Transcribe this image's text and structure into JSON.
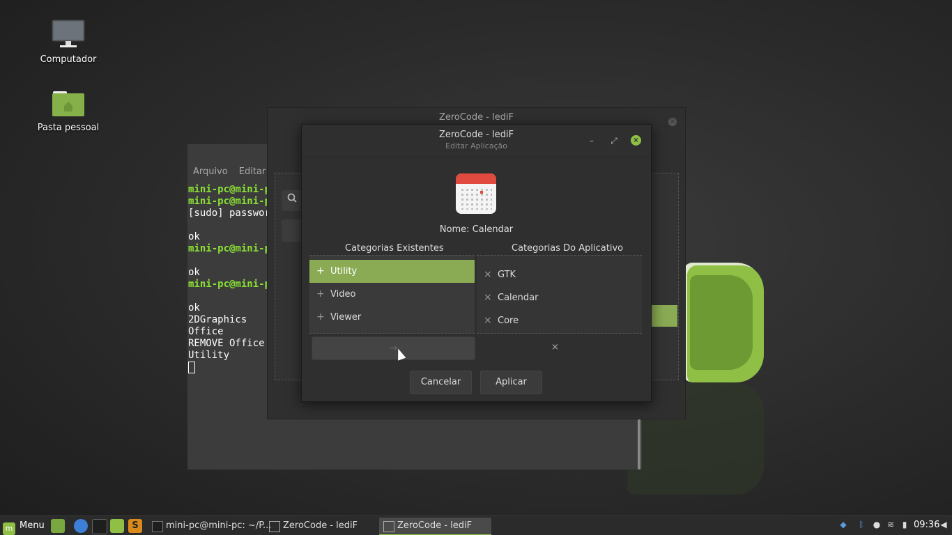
{
  "desktop": {
    "icons": [
      {
        "label": "Computador",
        "icon": "computer-icon"
      },
      {
        "label": "Pasta pessoal",
        "icon": "home-folder-icon"
      }
    ]
  },
  "terminal": {
    "menu": [
      "Arquivo",
      "Editar"
    ],
    "lines": [
      {
        "text": "mini-pc@mini-p",
        "style": "prompt"
      },
      {
        "text": "mini-pc@mini-p",
        "style": "prompt"
      },
      {
        "text": "[sudo] passwor",
        "style": "plain"
      },
      {
        "text": "",
        "style": "plain"
      },
      {
        "text": "ok",
        "style": "plain"
      },
      {
        "text": "mini-pc@mini-p",
        "style": "prompt"
      },
      {
        "text": "",
        "style": "plain"
      },
      {
        "text": "ok",
        "style": "plain"
      },
      {
        "text": "mini-pc@mini-p",
        "style": "prompt"
      },
      {
        "text": "",
        "style": "plain"
      },
      {
        "text": "ok",
        "style": "plain"
      },
      {
        "text": "2DGraphics",
        "style": "plain"
      },
      {
        "text": "Office",
        "style": "plain"
      },
      {
        "text": "REMOVE Office",
        "style": "plain"
      },
      {
        "text": "Utility",
        "style": "plain"
      }
    ]
  },
  "back_window": {
    "title": "ZeroCode - lediF"
  },
  "dialog": {
    "title": "ZeroCode - lediF",
    "subtitle": "Editar Aplicação",
    "app_icon": "calendar-icon",
    "app_name": "Nome: Calendar",
    "left_header": "Categorias Existentes",
    "right_header": "Categorias Do Aplicativo",
    "existing": [
      {
        "label": "Utility",
        "selected": true
      },
      {
        "label": "Video",
        "selected": false
      },
      {
        "label": "Viewer",
        "selected": false
      }
    ],
    "app_categories": [
      {
        "label": "GTK"
      },
      {
        "label": "Calendar"
      },
      {
        "label": "Core"
      }
    ],
    "move_button": "→",
    "remove_button": "×",
    "cancel": "Cancelar",
    "apply": "Aplicar"
  },
  "taskbar": {
    "menu_label": "Menu",
    "tasks": [
      {
        "label": "mini-pc@mini-pc: ~/P...",
        "active": false
      },
      {
        "label": "ZeroCode - lediF",
        "active": false
      },
      {
        "label": "ZeroCode - lediF",
        "active": true
      }
    ],
    "clock": "09:36"
  },
  "colors": {
    "accent": "#8fbf45",
    "selection": "#8aab54",
    "prompt": "#8ae234",
    "close_red": "#e04a3f"
  }
}
